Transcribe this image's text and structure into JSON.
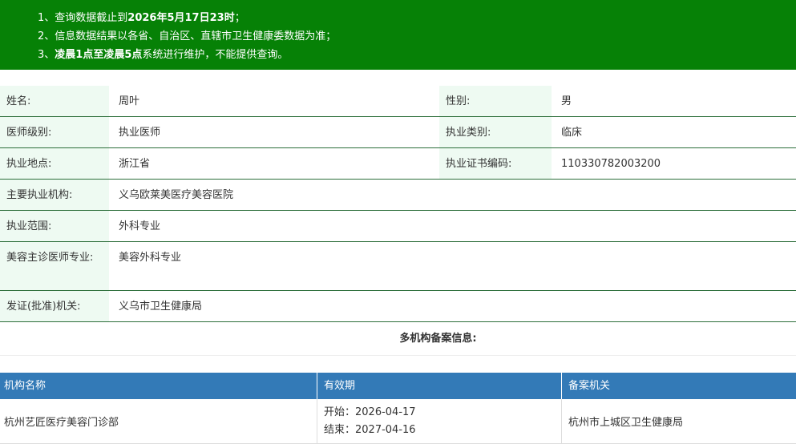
{
  "notice": {
    "line1_prefix": "1、查询数据截止到",
    "line1_bold": "2026年5月17日23时",
    "line1_suffix": "；",
    "line2": "2、信息数据结果以各省、自治区、直辖市卫生健康委数据为准；",
    "line3_prefix": "3、",
    "line3_bold": "凌晨1点至凌晨5点",
    "line3_suffix": "系统进行维护，不能提供查询。"
  },
  "info": {
    "name_label": "姓名:",
    "name_value": "周叶",
    "gender_label": "性别:",
    "gender_value": "男",
    "level_label": "医师级别:",
    "level_value": "执业医师",
    "category_label": "执业类别:",
    "category_value": "临床",
    "location_label": "执业地点:",
    "location_value": "浙江省",
    "cert_label": "执业证书编码:",
    "cert_value": "110330782003200",
    "org_label": "主要执业机构:",
    "org_value": "义乌欧莱美医疗美容医院",
    "scope_label": "执业范围:",
    "scope_value": "外科专业",
    "cosmetic_label": "美容主诊医师专业:",
    "cosmetic_value": "美容外科专业",
    "issuer_label": "发证(批准)机关:",
    "issuer_value": "义乌市卫生健康局"
  },
  "multi": {
    "title": "多机构备案信息:",
    "headers": [
      "机构名称",
      "有效期",
      "备案机关"
    ],
    "rows": [
      {
        "org": "杭州艺匠医疗美容门诊部",
        "start": "开始：2026-04-17",
        "end": "结束：2027-04-16",
        "authority": "杭州市上城区卫生健康局"
      }
    ]
  }
}
